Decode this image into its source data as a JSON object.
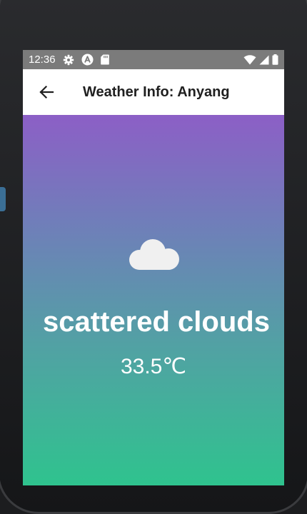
{
  "status_bar": {
    "time": "12:36",
    "icons": [
      "settings-icon",
      "autofill-icon",
      "sd-card-icon",
      "wifi-icon",
      "signal-icon",
      "battery-icon"
    ]
  },
  "app_bar": {
    "back_icon": "arrow-back-icon",
    "title": "Weather Info: Anyang"
  },
  "weather": {
    "icon": "cloud-icon",
    "description": "scattered clouds",
    "temperature": "33.5℃"
  },
  "colors": {
    "status_bar": "#7b7b7b",
    "gradient_top": "#8c5fc6",
    "gradient_bottom": "#2fc38e",
    "cloud": "#f0f0f0"
  }
}
